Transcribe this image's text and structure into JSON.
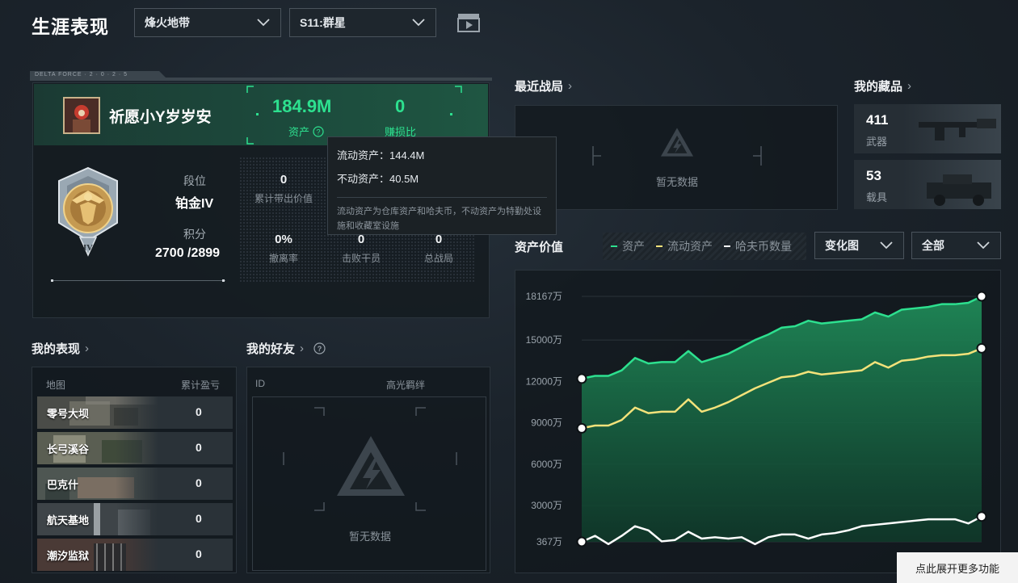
{
  "header": {
    "title": "生涯表现",
    "mode_select": "烽火地带",
    "season_select": "S11:群星"
  },
  "profile": {
    "banner_text": "DELTA FORCE · 2 · 0 · 2 · 5",
    "player_name": "祈愿小Y岁岁安",
    "asset_value": "184.9M",
    "asset_label": "资产",
    "profit_ratio": "0",
    "profit_ratio_label": "赚损比",
    "rank_label": "段位",
    "rank_value": "铂金IV",
    "rank_badge": "IV",
    "score_label": "积分",
    "score_value": "2700 /2899",
    "stats": [
      {
        "value": "0",
        "label": "累计带出价值"
      },
      {
        "value": "0%",
        "label": "撤离率"
      },
      {
        "value": "0",
        "label": "击败干员"
      },
      {
        "value": "0",
        "label": "总战局"
      }
    ]
  },
  "tooltip": {
    "liquid_label": "流动资产：144.4M",
    "fixed_label": "不动资产：40.5M",
    "note": "流动资产为仓库资产和哈夫币，不动资产为特勤处设施和收藏室设施"
  },
  "performance": {
    "heading": "我的表现",
    "col_map": "地图",
    "col_profit": "累计盈亏",
    "rows": [
      {
        "map": "零号大坝",
        "value": "0"
      },
      {
        "map": "长弓溪谷",
        "value": "0"
      },
      {
        "map": "巴克什",
        "value": "0"
      },
      {
        "map": "航天基地",
        "value": "0"
      },
      {
        "map": "潮汐监狱",
        "value": "0"
      }
    ]
  },
  "friends": {
    "heading": "我的好友",
    "col_id": "ID",
    "col_bond": "高光羁绊",
    "empty": "暂无数据"
  },
  "recent": {
    "heading": "最近战局",
    "empty": "暂无数据"
  },
  "collection": {
    "heading": "我的藏品",
    "items": [
      {
        "count": "411",
        "label": "武器"
      },
      {
        "count": "53",
        "label": "载具"
      }
    ]
  },
  "asset_chart": {
    "heading": "资产价值",
    "view_select": "变化图",
    "range_select": "全部",
    "expand_button": "点此展开更多功能"
  },
  "colors": {
    "green": "#2de08f",
    "yellow": "#f3e27a",
    "white": "#ffffff"
  },
  "chart_data": {
    "type": "area",
    "title": "",
    "ylabel": "",
    "xlabel": "",
    "ylim": [
      367,
      18167
    ],
    "y_ticks": [
      "18167万",
      "15000万",
      "12000万",
      "9000万",
      "6000万",
      "3000万",
      "367万"
    ],
    "grid": true,
    "legend_position": "top",
    "series": [
      {
        "name": "资产",
        "color": "#2de08f",
        "values": [
          12200,
          12400,
          12400,
          12800,
          13700,
          13300,
          13400,
          13400,
          14200,
          13400,
          13700,
          14000,
          14500,
          15000,
          15400,
          15900,
          16000,
          16400,
          16200,
          16300,
          16400,
          16500,
          17000,
          16700,
          17200,
          17300,
          17400,
          17600,
          17600,
          17700,
          18167
        ]
      },
      {
        "name": "流动资产",
        "color": "#f3e27a",
        "values": [
          8600,
          8800,
          8800,
          9200,
          10100,
          9700,
          9800,
          9800,
          10700,
          9800,
          10100,
          10500,
          11000,
          11500,
          11900,
          12300,
          12400,
          12700,
          12500,
          12600,
          12700,
          12800,
          13400,
          13000,
          13500,
          13600,
          13800,
          13900,
          13900,
          14000,
          14400
        ]
      },
      {
        "name": "哈夫币数量",
        "color": "#ffffff",
        "values": [
          367,
          800,
          200,
          800,
          1500,
          1200,
          400,
          500,
          1100,
          600,
          700,
          600,
          700,
          200,
          700,
          900,
          900,
          600,
          900,
          1000,
          1200,
          1500,
          1600,
          1700,
          1800,
          1900,
          2000,
          2000,
          2000,
          1700,
          2200
        ]
      }
    ]
  }
}
